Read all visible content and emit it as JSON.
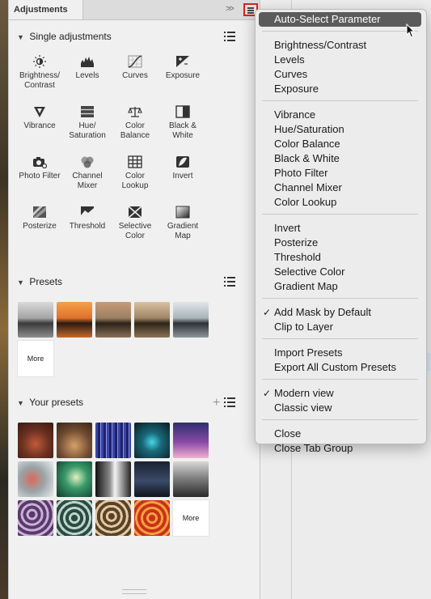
{
  "panel": {
    "tab_title": "Adjustments",
    "collapse_chevron": ">>",
    "single_adjustments": {
      "title": "Single adjustments",
      "items": [
        {
          "label": "Brightness/\nContrast",
          "icon": "sun-icon"
        },
        {
          "label": "Levels",
          "icon": "histogram-icon"
        },
        {
          "label": "Curves",
          "icon": "curves-icon"
        },
        {
          "label": "Exposure",
          "icon": "exposure-icon"
        },
        {
          "label": "Vibrance",
          "icon": "vibrance-triangle-icon"
        },
        {
          "label": "Hue/\nSaturation",
          "icon": "hue-saturation-icon"
        },
        {
          "label": "Color\nBalance",
          "icon": "balance-scale-icon"
        },
        {
          "label": "Black &\nWhite",
          "icon": "black-white-icon"
        },
        {
          "label": "Photo Filter",
          "icon": "camera-icon"
        },
        {
          "label": "Channel\nMixer",
          "icon": "channel-mixer-icon"
        },
        {
          "label": "Color\nLookup",
          "icon": "grid-icon"
        },
        {
          "label": "Invert",
          "icon": "invert-icon"
        },
        {
          "label": "Posterize",
          "icon": "posterize-icon"
        },
        {
          "label": "Threshold",
          "icon": "threshold-icon"
        },
        {
          "label": "Selective\nColor",
          "icon": "selective-color-icon"
        },
        {
          "label": "Gradient\nMap",
          "icon": "gradient-map-icon"
        }
      ]
    },
    "presets": {
      "title": "Presets",
      "more_label": "More"
    },
    "your_presets": {
      "title": "Your presets",
      "more_label": "More"
    }
  },
  "menu": {
    "groups": [
      [
        {
          "label": "Auto-Select Parameter",
          "selected": true
        }
      ],
      [
        {
          "label": "Brightness/Contrast"
        },
        {
          "label": "Levels"
        },
        {
          "label": "Curves"
        },
        {
          "label": "Exposure"
        }
      ],
      [
        {
          "label": "Vibrance"
        },
        {
          "label": "Hue/Saturation"
        },
        {
          "label": "Color Balance"
        },
        {
          "label": "Black & White"
        },
        {
          "label": "Photo Filter"
        },
        {
          "label": "Channel Mixer"
        },
        {
          "label": "Color Lookup"
        }
      ],
      [
        {
          "label": "Invert"
        },
        {
          "label": "Posterize"
        },
        {
          "label": "Threshold"
        },
        {
          "label": "Selective Color"
        },
        {
          "label": "Gradient Map"
        }
      ],
      [
        {
          "label": "Add Mask by Default",
          "checked": true
        },
        {
          "label": "Clip to Layer"
        }
      ],
      [
        {
          "label": "Import Presets"
        },
        {
          "label": "Export All Custom Presets"
        }
      ],
      [
        {
          "label": "Modern view",
          "checked": true
        },
        {
          "label": "Classic view"
        }
      ],
      [
        {
          "label": "Close"
        },
        {
          "label": "Close Tab Group"
        }
      ]
    ],
    "check_glyph": "✓"
  },
  "colors": {
    "highlight": "#5b5b5b",
    "annotation_outline": "#e0201a"
  }
}
